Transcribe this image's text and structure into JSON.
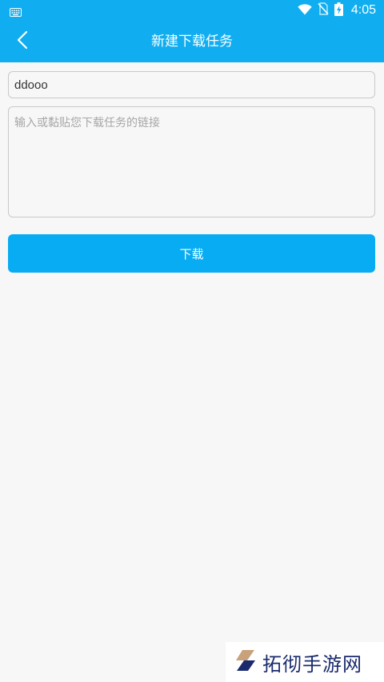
{
  "status_bar": {
    "time": "4:05",
    "icons": [
      "keyboard-icon",
      "wifi-icon",
      "no-sim-icon",
      "battery-charging-icon"
    ]
  },
  "app_bar": {
    "title": "新建下载任务",
    "back_icon": "chevron-left-icon"
  },
  "form": {
    "name_value": "ddooo",
    "url_placeholder": "输入或黏贴您下载任务的链接",
    "url_value": "",
    "download_label": "下载"
  },
  "watermark": {
    "text": "拓彻手游网"
  },
  "colors": {
    "accent": "#10aef0",
    "button": "#08acf2",
    "background": "#f7f7f7",
    "watermark_text": "#1a2a6c",
    "watermark_logo_accent": "#c8a27a"
  }
}
